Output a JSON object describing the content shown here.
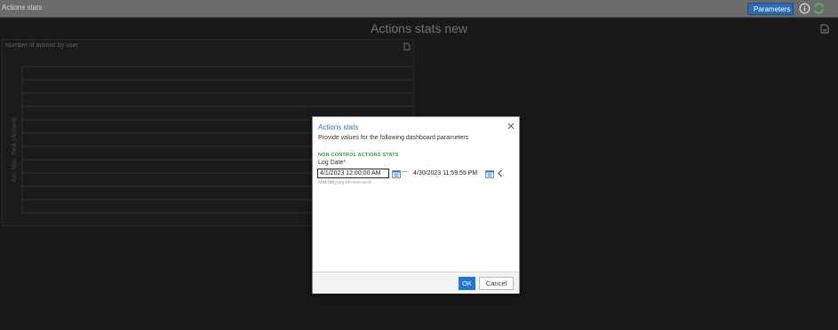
{
  "app": {
    "breadcrumb": "Actions stats",
    "parameters_label": "Parameters",
    "dashboard_title": "Actions stats new"
  },
  "panel": {
    "title": "Number of actions by user",
    "y_axis_label": "Aic. Nos. Task (Acount)"
  },
  "dialog": {
    "title": "Actions stats",
    "description": "Provide values for the following dashboard parameters",
    "section": "NON CONTROL ACTIONS STATS",
    "field_label": "Log Date",
    "required_mark": "*",
    "start_value": "4/1/2023 12:00:00 AM",
    "range_separator": "—",
    "end_value": "4/30/2023 11:59:59 PM",
    "format_hint": "MM/dd/yyyy hh:mm:ss tt",
    "ok_label": "OK",
    "cancel_label": "Cancel"
  },
  "colors": {
    "accent": "#2b6cb0",
    "ok_button": "#1f77d0",
    "section_green": "#2e9b47",
    "dialog_title": "#2a73c8",
    "required_red": "#c62828"
  },
  "icons": {
    "info": "info-circle-icon",
    "refresh": "refresh-icon",
    "export": "export-icon",
    "close": "close-icon",
    "calendar": "calendar-icon",
    "chevron": "chevron-left-icon"
  }
}
